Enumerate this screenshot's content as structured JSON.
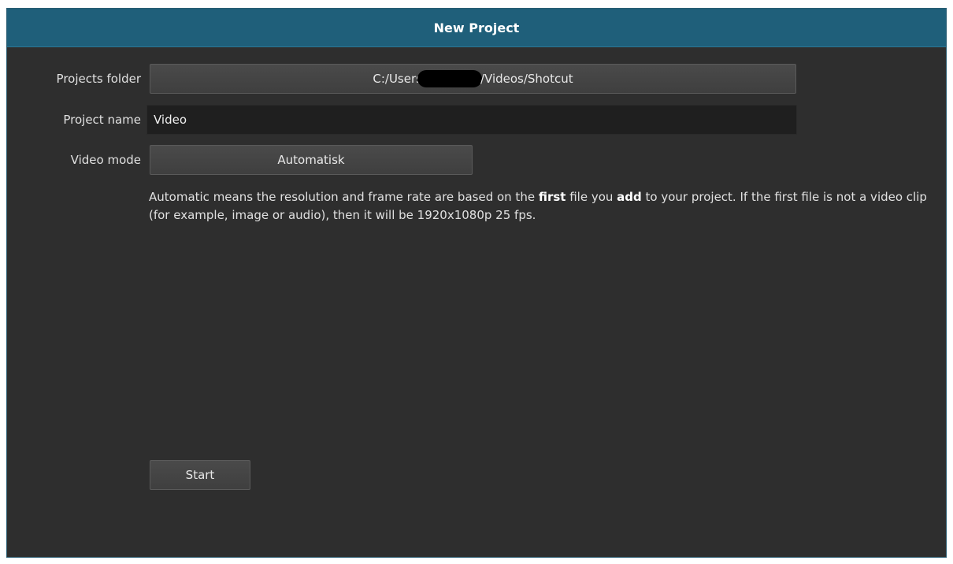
{
  "dialog": {
    "title": "New Project"
  },
  "form": {
    "projects_folder_label": "Projects folder",
    "projects_folder_prefix": "C:/Users",
    "projects_folder_suffix": "/Videos/Shotcut",
    "project_name_label": "Project name",
    "project_name_value": "Video",
    "video_mode_label": "Video mode",
    "video_mode_value": "Automatisk"
  },
  "description": {
    "part1": "Automatic means the resolution and frame rate are based on the ",
    "bold1": "first",
    "part2": " file you ",
    "bold2": "add",
    "part3": " to your project. If the first file is not a video clip (for example, image or audio), then it will be 1920x1080p 25 fps."
  },
  "actions": {
    "start_label": "Start"
  },
  "colors": {
    "title_bar": "#1f5f7a",
    "background": "#2e2e2e",
    "input_bg": "#1f1f1f"
  }
}
